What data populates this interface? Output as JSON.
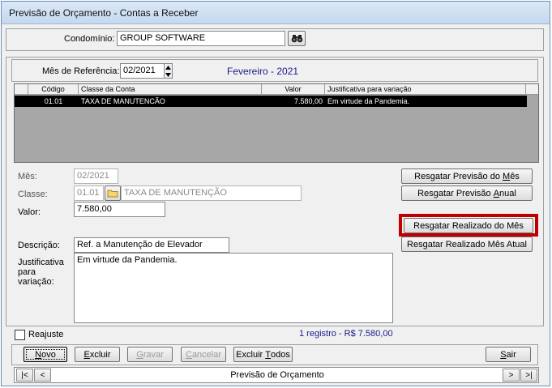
{
  "window": {
    "title": "Previsão de Orçamento - Contas a Receber"
  },
  "condominio": {
    "label": "Condomínio:",
    "value": "GROUP SOFTWARE",
    "search_icon": "binoculars-icon"
  },
  "referencia": {
    "label": "Mês de Referência:",
    "value": "02/2021",
    "month_name": "Fevereiro - 2021"
  },
  "grid": {
    "columns": [
      "Código",
      "Classe da Conta",
      "Valor",
      "Justificativa para variação"
    ],
    "rows": [
      {
        "codigo": "01.01",
        "classe": "TAXA DE MANUTENCÃO",
        "valor": "7.580,00",
        "justificativa": "Em virtude da Pandemia."
      }
    ]
  },
  "form": {
    "mes_label": "Mês:",
    "mes_value": "02/2021",
    "classe_label": "Classe:",
    "classe_code": "01.01",
    "classe_name": "TAXA DE MANUTENÇÃO",
    "valor_label": "Valor:",
    "valor_value": "7.580,00",
    "descricao_label": "Descrição:",
    "descricao_value": "Ref. a Manutenção de Elevador",
    "justificativa_label_1": "Justificativa",
    "justificativa_label_2": "para",
    "justificativa_label_3": "variação:",
    "justificativa_value": "Em virtude da Pandemia."
  },
  "actions": {
    "previsao_mes_pre": "Resgatar Previsão do ",
    "previsao_mes_u": "M",
    "previsao_mes_post": "ês",
    "previsao_anual_pre": "Resgatar Previsão ",
    "previsao_anual_u": "A",
    "previsao_anual_post": "nual",
    "realizado_mes": "Resgatar Realizado do Mês",
    "realizado_mes_atual": "Resgatar Realizado Mês Atual"
  },
  "reajuste": {
    "label": "Reajuste",
    "checked": false
  },
  "summary": "1 registro - R$ 7.580,00",
  "toolbar": {
    "novo_u": "N",
    "novo_rest": "ovo",
    "excluir_u": "E",
    "excluir_rest": "xcluir",
    "gravar_u": "G",
    "gravar_rest": "ravar",
    "cancelar_u": "C",
    "cancelar_rest": "ancelar",
    "excluir_todos_pre": "Excluir ",
    "excluir_todos_u": "T",
    "excluir_todos_rest": "odos",
    "sair_u": "S",
    "sair_rest": "air"
  },
  "navigator": {
    "first": "|<",
    "prev": "<",
    "label": "Previsão de Orçamento",
    "next": ">",
    "last": ">|"
  }
}
